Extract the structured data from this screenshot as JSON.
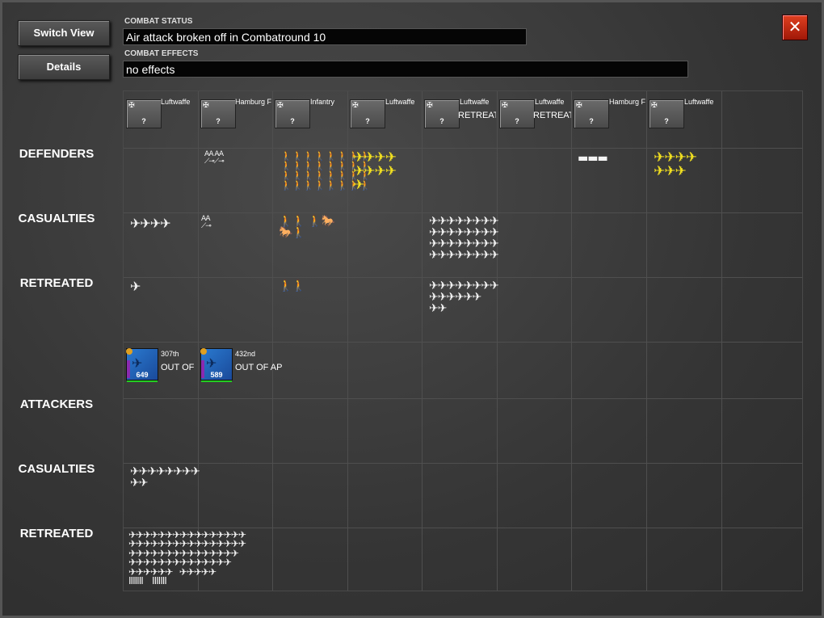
{
  "buttons": {
    "switch_view": "Switch View",
    "details": "Details"
  },
  "status": {
    "combat_status_label": "COMBAT STATUS",
    "combat_status": "Air attack broken off in Combatround  10",
    "combat_effects_label": "COMBAT EFFECTS",
    "combat_effects": "no effects"
  },
  "close_glyph": "✕",
  "rows": {
    "defenders": "DEFENDERS",
    "def_casualties": "CASUALTIES",
    "def_retreated": "RETREATED",
    "attackers": "ATTACKERS",
    "att_casualties": "CASUALTIES",
    "att_retreated": "RETREATED"
  },
  "defender_units": [
    {
      "name": "Luftwaffe",
      "status": "",
      "q": "?"
    },
    {
      "name": "Hamburg F",
      "status": "",
      "q": "?"
    },
    {
      "name": "Infantry",
      "status": "",
      "q": "?"
    },
    {
      "name": "Luftwaffe",
      "status": "",
      "q": "?"
    },
    {
      "name": "Luftwaffe",
      "status": "RETREAT",
      "q": "?"
    },
    {
      "name": "Luftwaffe",
      "status": "RETREAT",
      "q": "?"
    },
    {
      "name": "Hamburg F",
      "status": "",
      "q": "?"
    },
    {
      "name": "Luftwaffe",
      "status": "",
      "q": "?"
    }
  ],
  "attacker_units": [
    {
      "name": "307th",
      "status": "OUT OF AP",
      "strength": "649"
    },
    {
      "name": "432nd",
      "status": "OUT OF AP",
      "strength": "589"
    }
  ],
  "icons": {
    "plane": "✈",
    "aa": "AA",
    "soldier": "🚶",
    "tank": "▬"
  },
  "colors": {
    "accent_close": "#c8301a",
    "friendly_plane": "#f2e020"
  }
}
